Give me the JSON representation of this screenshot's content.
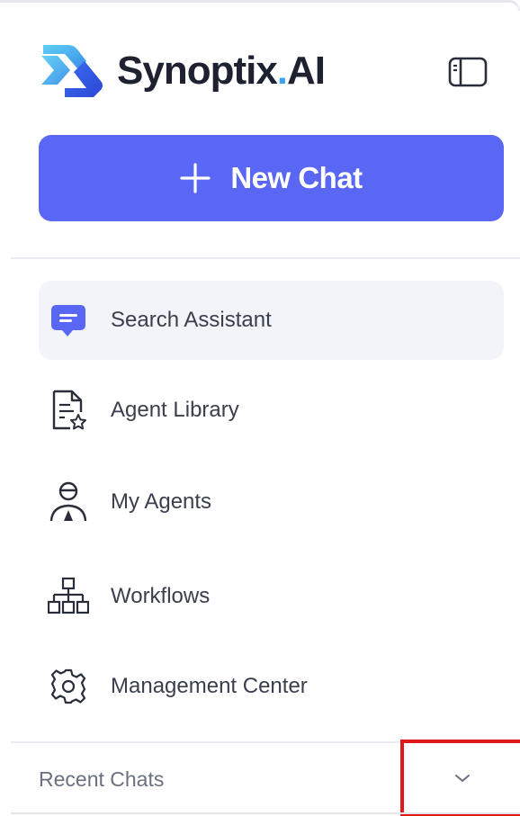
{
  "brand": {
    "name_main": "Synoptix",
    "name_dot": ".",
    "name_suffix": "AI"
  },
  "new_chat": {
    "label": "New Chat"
  },
  "nav": {
    "items": [
      {
        "label": "Search Assistant",
        "icon": "chat-bubble-icon",
        "active": true
      },
      {
        "label": "Agent Library",
        "icon": "document-star-icon",
        "active": false
      },
      {
        "label": "My Agents",
        "icon": "agent-person-icon",
        "active": false
      },
      {
        "label": "Workflows",
        "icon": "workflow-tree-icon",
        "active": false
      },
      {
        "label": "Management Center",
        "icon": "gear-icon",
        "active": false
      }
    ]
  },
  "recent_chats": {
    "label": "Recent Chats",
    "toggle_icon": "chevron-down-icon"
  },
  "colors": {
    "accent": "#5a67f4",
    "brand_blue": "#3fa2f2",
    "active_bg": "#f2f4f9",
    "highlight_box": "#e0171c"
  }
}
